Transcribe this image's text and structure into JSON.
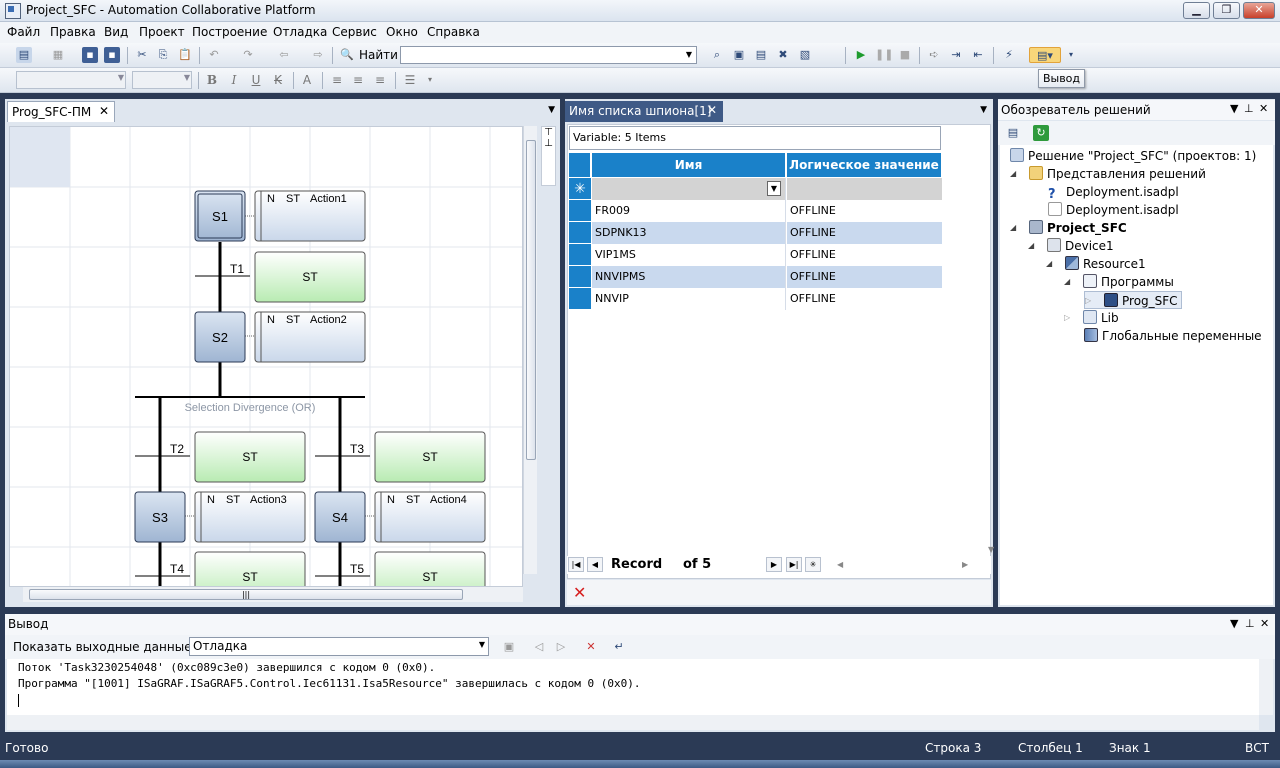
{
  "window": {
    "title": "Project_SFC - Automation Collaborative Platform",
    "minimize": "▁",
    "maximize": "❐",
    "close": "✕"
  },
  "menu": [
    "Файл",
    "Правка",
    "Вид",
    "Проект",
    "Построение",
    "Отладка",
    "Сервис",
    "Окно",
    "Справка"
  ],
  "toolbar": {
    "find_label": "Найти",
    "find_value": "",
    "tooltip": "Вывод"
  },
  "editor": {
    "tab_label": "Prog_SFC-ПМ",
    "steps": [
      "S1",
      "S2",
      "S3",
      "S4"
    ],
    "transitions": [
      "T1",
      "T2",
      "T3",
      "T4",
      "T5"
    ],
    "actions": [
      {
        "qualifier": "N",
        "lang": "ST",
        "name": "Action1"
      },
      {
        "qualifier": "N",
        "lang": "ST",
        "name": "Action2"
      },
      {
        "qualifier": "N",
        "lang": "ST",
        "name": "Action3"
      },
      {
        "qualifier": "N",
        "lang": "ST",
        "name": "Action4"
      }
    ],
    "transition_code_label": "ST",
    "divergence_label": "Selection Divergence (OR)"
  },
  "watch": {
    "tab_label": "Имя списка шпиона[1]",
    "variable_count": "Variable: 5 Items",
    "columns": [
      "Имя",
      "Логическое значение"
    ],
    "rows": [
      {
        "name": "FR009",
        "value": "OFFLINE"
      },
      {
        "name": "SDPNK13",
        "value": "OFFLINE"
      },
      {
        "name": "VIP1MS",
        "value": "OFFLINE"
      },
      {
        "name": "NNVIPMS",
        "value": "OFFLINE"
      },
      {
        "name": "NNVIP",
        "value": "OFFLINE"
      }
    ],
    "record_label": "Record",
    "record_of": "of 5"
  },
  "solution_explorer": {
    "title": "Обозреватель решений",
    "nodes": [
      {
        "label": "Решение \"Project_SFC\"  (проектов: 1)"
      },
      {
        "label": "Представления решений"
      },
      {
        "label": "Deployment.isadpl"
      },
      {
        "label": "Deployment.isadpl"
      },
      {
        "label": "Project_SFC"
      },
      {
        "label": "Device1"
      },
      {
        "label": "Resource1"
      },
      {
        "label": "Программы"
      },
      {
        "label": "Prog_SFC"
      },
      {
        "label": "Lib"
      },
      {
        "label": "Глобальные переменные"
      }
    ]
  },
  "output": {
    "title": "Вывод",
    "show_label": "Показать выходные данные от:",
    "source": "Отладка",
    "lines": [
      "Поток 'Task3230254048' (0xc089c3e0) завершился с кодом 0 (0x0).",
      "Программа \"[1001] ISaGRAF.ISaGRAF5.Control.Iec61131.Isa5Resource\" завершилась с кодом 0 (0x0)."
    ]
  },
  "status": {
    "ready": "Готово",
    "row": "Строка 3",
    "col": "Столбец 1",
    "char": "Знак 1",
    "mode": "ВСТ"
  },
  "colors": {
    "accent": "#1a81c9",
    "step_fill": "#b9c9df",
    "transition_fill": "#c9efc4",
    "chrome": "#2b3a55"
  }
}
